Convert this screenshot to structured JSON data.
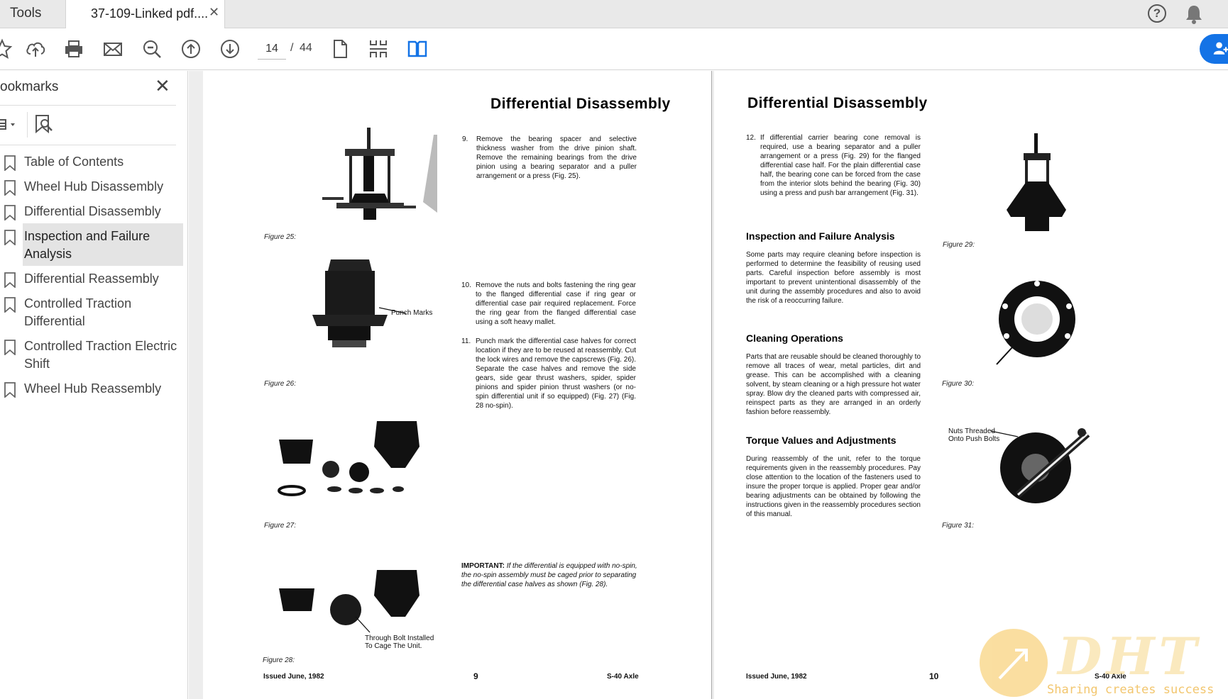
{
  "tabs": {
    "tools_label": "Tools",
    "doc_title": "37-109-Linked pdf....",
    "close_symbol": "✕"
  },
  "header": {
    "help_icon": "help-icon",
    "help_symbol": "?",
    "notification_icon": "bell-icon"
  },
  "toolbar": {
    "current_page": "14",
    "page_separator": "/",
    "total_pages": "44",
    "icons": [
      "star-icon",
      "upload-icon",
      "print-icon",
      "email-icon",
      "zoom-icon",
      "prev-page-icon",
      "next-page-icon",
      "single-page-icon",
      "scroll-mode-icon",
      "two-page-icon",
      "share-user-icon"
    ]
  },
  "sidebar": {
    "title": "ookmarks",
    "close_symbol": "✕",
    "items": [
      {
        "label": "Table of Contents"
      },
      {
        "label": "Wheel Hub Disassembly"
      },
      {
        "label": "Differential Disassembly"
      },
      {
        "label": "Inspection and Failure Analysis",
        "selected": true
      },
      {
        "label": "Differential Reassembly"
      },
      {
        "label": "Controlled Traction Differential"
      },
      {
        "label": "Controlled Traction Electric Shift"
      },
      {
        "label": "Wheel Hub Reassembly"
      }
    ]
  },
  "left_page": {
    "heading": "Differential Disassembly",
    "step9_num": "9.",
    "step9": "Remove the bearing spacer and selective thickness washer from the drive pinion shaft. Remove the remaining bearings from the drive pinion using a bearing separator and a puller arrangement or a press (Fig. 25).",
    "step10_num": "10.",
    "step10": "Remove the nuts and bolts fastening the ring gear to the flanged differential case if ring gear or differential case pair required replacement. Force the ring gear from the flanged differential case using a soft heavy mallet.",
    "step11_num": "11.",
    "step11": "Punch mark the differential case halves for correct location if they are to be reused at reassembly. Cut the lock wires and remove the capscrews (Fig. 26). Separate the case halves and remove the side gears, side gear thrust washers, spider, spider pinions and spider pinion thrust washers (or no-spin differential unit if so equipped) (Fig. 27) (Fig. 28 no-spin).",
    "important_label": "IMPORTANT:",
    "important_text": " If the differential is equipped with no-spin, the no-spin assembly must be caged prior to separating the differential case halves as shown (Fig. 28).",
    "fig25": "Figure 25:",
    "fig26": "Figure 26:",
    "fig27": "Figure 27:",
    "fig28": "Figure 28:",
    "callout_punch": "Punch Marks",
    "callout_bolt_1": "Through Bolt Installed",
    "callout_bolt_2": "To Cage The Unit.",
    "footer_issued": "Issued June, 1982",
    "page_number": "9",
    "footer_model": "S-40 Axle"
  },
  "right_page": {
    "heading": "Differential Disassembly",
    "step12_num": "12.",
    "step12": "If differential carrier bearing cone removal is required, use a bearing separator and a puller arrangement or a press (Fig. 29) for the flanged differential case half. For the plain differential case half, the bearing cone can be forced from the case from the interior slots behind the bearing (Fig. 30) using a press and push bar arrangement (Fig. 31).",
    "inspection_heading": "Inspection and Failure Analysis",
    "inspection_text": "Some parts may require cleaning before inspection is performed to determine the feasibility of reusing used parts. Careful inspection before assembly is most important to prevent unintentional disassembly of the unit during the assembly procedures and also to avoid the risk of a reoccurring failure.",
    "cleaning_heading": "Cleaning Operations",
    "cleaning_text": "Parts that are reusable should be cleaned thoroughly to remove all traces of wear, metal particles, dirt and grease. This can be accomplished with a cleaning solvent, by steam cleaning or a high pressure hot water spray. Blow dry the cleaned parts with compressed air, reinspect parts as they are arranged in an orderly fashion before reassembly.",
    "torque_heading": "Torque Values and Adjustments",
    "torque_text": "During reassembly of the unit, refer to the torque requirements given in the reassembly procedures. Pay close attention to the location of the fasteners used to insure the proper torque is applied. Proper gear and/or bearing adjustments can be obtained by following the instructions given in the reassembly procedures section of this manual.",
    "fig29": "Figure 29:",
    "fig30": "Figure 30:",
    "fig31": "Figure 31:",
    "callout_nuts_1": "Nuts Threaded",
    "callout_nuts_2": "Onto Push Bolts",
    "footer_issued": "Issued June, 1982",
    "page_number": "10",
    "footer_model": "S-40 Axle"
  },
  "watermark": {
    "logo_text": "DHT",
    "tagline": "Sharing creates success"
  },
  "colors": {
    "accent_blue": "#1473e6",
    "tab_bar": "#e9e9e9",
    "selected_bookmark": "#e4e4e4",
    "doc_background": "#ededed"
  }
}
